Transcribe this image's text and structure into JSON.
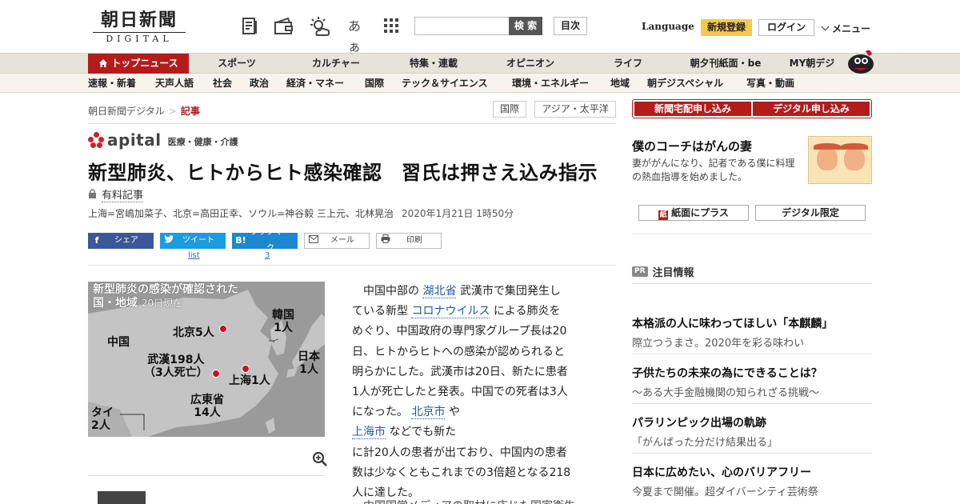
{
  "header": {
    "logo_main": "朝日新聞",
    "logo_sub": "DIGITAL",
    "tools": [
      "memo-icon",
      "wallet-icon",
      "weather-icon",
      "font-size-icon",
      "grid-icon"
    ],
    "font_glyph": "あぁ",
    "search_placeholder": "",
    "search_label": "検 索",
    "toc_label": "目次",
    "language_label": "Language",
    "register_label": "新規登録",
    "login_label": "ログイン",
    "menu_label": "メニュー"
  },
  "nav_primary": [
    "トップニュース",
    "スポーツ",
    "カルチャー",
    "特集・連載",
    "オピニオン",
    "ライフ",
    "朝夕刊紙面・be",
    "MY朝デジ"
  ],
  "nav_secondary": [
    "速報・新着",
    "天声人語",
    "社会",
    "政治",
    "経済・マネー",
    "国際",
    "テック＆サイエンス",
    "環境・エネルギー",
    "地域",
    "朝デジスペシャル",
    "写真・動画"
  ],
  "breadcrumb": {
    "home": "朝日新聞デジタル",
    "sep": ">",
    "current": "記事"
  },
  "tags": [
    "国際",
    "アジア・太平洋"
  ],
  "apital": {
    "name": "apital",
    "category": "医療・健康・介護"
  },
  "article": {
    "headline": "新型肺炎、ヒトからヒト感染確認　習氏は押さえ込み指示",
    "paid_label": "有料記事",
    "byline": "上海=宮嶋加菜子、北京=高田正幸、ソウル=神谷毅 三上元、北林晃治",
    "date": "2020年1月21日 1時50分",
    "body_lines": [
      [
        "　中国中部の ",
        "湖北省",
        " 武漢市で集団発生し"
      ],
      [
        "ている新型 ",
        "コロナウイルス",
        " による肺炎を"
      ],
      [
        "めぐり、中国政府の専門家グループ長は20",
        "",
        ""
      ],
      [
        "日、ヒトからヒトへの感染が認められると",
        "",
        ""
      ],
      [
        "明らかにした。武漢市は20日、新たに患者",
        "",
        ""
      ],
      [
        "1人が死亡したと発表。中国での死者は3人",
        "",
        ""
      ],
      [
        "になった。 ",
        "北京市",
        " や "
      ],
      [
        "",
        "上海市",
        " などでも新た"
      ],
      [
        "に計20人の患者が出ており、中国内の患者",
        "",
        ""
      ],
      [
        "数は少なくともこれまでの3倍超となる218",
        "",
        ""
      ],
      [
        "人に達した。",
        "",
        ""
      ]
    ],
    "next_line": "　中国国営メディアの取材に応じた国家衛生"
  },
  "share": {
    "facebook": "シェア",
    "twitter": "ツイート",
    "twitter_count": "list",
    "hatena": "ブックマーク",
    "hatena_count": "3",
    "mail": "メール",
    "print": "印刷"
  },
  "map": {
    "title_l1": "新型肺炎の感染が確認された",
    "title_l2": "国・地域",
    "title_sub": "20日現在",
    "labels": {
      "china": "中国",
      "beijing": "北京5人",
      "korea_1": "韓国",
      "korea_2": "1人",
      "japan_1": "日本",
      "japan_2": "1人",
      "wuhan_1": "武漢198人",
      "wuhan_2": "（3人死亡）",
      "shanghai": "上海1人",
      "guangdong_1": "広東省",
      "guangdong_2": "14人",
      "thai_1": "タイ",
      "thai_2": "2人"
    },
    "colors": {
      "land": "#c4c4c4",
      "sea": "#9a9a9a",
      "dot": "#c8102e"
    }
  },
  "sidebar": {
    "subscribe_paper": "新聞宅配申し込み",
    "subscribe_digital": "デジタル申し込み",
    "feature_title": "僕のコーチはがんの妻",
    "feature_desc": "妻ががんになり、記者である僕に料理の熱血指導を始めました。",
    "btn_paper_plus": "紙面にプラス",
    "btn_digital_only": "デジタル限定",
    "pr_badge": "PR",
    "pr_heading": "注目情報",
    "pr_items": [
      {
        "title": "本格派の人に味わってほしい「本麒麟」",
        "desc": "際立つうまさ。2020年を彩る味わい"
      },
      {
        "title": "子供たちの未来の為にできることは？",
        "desc": "～ある大手金融機関の知られざる挑戦～"
      },
      {
        "title": "パラリンピック出場の軌跡",
        "desc": "「がんばった分だけ結果出る」"
      },
      {
        "title": "日本に広めたい、心のバリアフリー",
        "desc": "今夏まで開催。超ダイバーシティ芸術祭"
      }
    ]
  },
  "colors": {
    "brand_red": "#b41c1c",
    "accent_yellow": "#f4c94a",
    "link_blue": "#1e5aa8"
  }
}
